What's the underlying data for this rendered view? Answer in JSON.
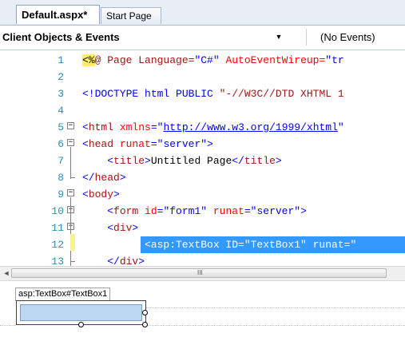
{
  "tabs": [
    {
      "label": "Default.aspx*"
    },
    {
      "label": "Start Page"
    }
  ],
  "navbar": {
    "objects_label": "Client Objects & Events",
    "dropdown_arrow": "▼",
    "events_label": "(No Events)"
  },
  "editor": {
    "lines": [
      {
        "num": "1",
        "parts": [
          {
            "t": "<%",
            "c": "hl"
          },
          {
            "t": "@ Page Language=",
            "c": "mr"
          },
          {
            "t": "\"C#\"",
            "c": "bl"
          },
          {
            "t": " AutoEventWireup=",
            "c": "rd"
          },
          {
            "t": "\"tr",
            "c": "bl"
          }
        ]
      },
      {
        "num": "2",
        "parts": []
      },
      {
        "num": "3",
        "parts": [
          {
            "t": "<!DOCTYPE html PUBLIC ",
            "c": "bl"
          },
          {
            "t": "\"-//W3C//DTD XHTML 1",
            "c": "mr"
          }
        ]
      },
      {
        "num": "4",
        "parts": []
      },
      {
        "num": "5",
        "parts": [
          {
            "t": "<",
            "c": "bl"
          },
          {
            "t": "html ",
            "c": "mr"
          },
          {
            "t": "xmlns",
            "c": "rd"
          },
          {
            "t": "=",
            "c": "bl"
          },
          {
            "t": "\"",
            "c": "bl"
          },
          {
            "t": "http://www.w3.org/1999/xhtml",
            "c": "lk"
          },
          {
            "t": "\"",
            "c": "bl"
          }
        ]
      },
      {
        "num": "6",
        "parts": [
          {
            "t": "<",
            "c": "bl"
          },
          {
            "t": "head ",
            "c": "mr"
          },
          {
            "t": "runat",
            "c": "rd"
          },
          {
            "t": "=\"server\">",
            "c": "bl"
          }
        ]
      },
      {
        "num": "7",
        "parts": [
          {
            "t": "    <",
            "c": "bl"
          },
          {
            "t": "title",
            "c": "mr"
          },
          {
            "t": ">",
            "c": "bl"
          },
          {
            "t": "Untitled Page",
            "c": "tx"
          },
          {
            "t": "</",
            "c": "bl"
          },
          {
            "t": "title",
            "c": "mr"
          },
          {
            "t": ">",
            "c": "bl"
          }
        ]
      },
      {
        "num": "8",
        "parts": [
          {
            "t": "</",
            "c": "bl"
          },
          {
            "t": "head",
            "c": "mr"
          },
          {
            "t": ">",
            "c": "bl"
          }
        ]
      },
      {
        "num": "9",
        "parts": [
          {
            "t": "<",
            "c": "bl"
          },
          {
            "t": "body",
            "c": "mr"
          },
          {
            "t": ">",
            "c": "bl"
          }
        ]
      },
      {
        "num": "10",
        "parts": [
          {
            "t": "    <",
            "c": "bl"
          },
          {
            "t": "form ",
            "c": "mr"
          },
          {
            "t": "id",
            "c": "rd"
          },
          {
            "t": "=\"form1\" ",
            "c": "bl"
          },
          {
            "t": "runat",
            "c": "rd"
          },
          {
            "t": "=\"server\">",
            "c": "bl"
          }
        ]
      },
      {
        "num": "11",
        "parts": [
          {
            "t": "    <",
            "c": "bl"
          },
          {
            "t": "div",
            "c": "mr"
          },
          {
            "t": ">",
            "c": "bl"
          }
        ]
      },
      {
        "num": "12",
        "selected_text": "<asp:TextBox ID=\"TextBox1\" runat=\""
      },
      {
        "num": "13",
        "parts": [
          {
            "t": "    </",
            "c": "bl"
          },
          {
            "t": "div",
            "c": "mr"
          },
          {
            "t": ">",
            "c": "bl"
          }
        ]
      }
    ]
  },
  "scrollbar": {
    "left_arrow": "◄",
    "grip": "III"
  },
  "design": {
    "tag_label": "asp:TextBox#TextBox1"
  },
  "icons": {
    "fold_minus": "−",
    "fold_plus": "+"
  }
}
